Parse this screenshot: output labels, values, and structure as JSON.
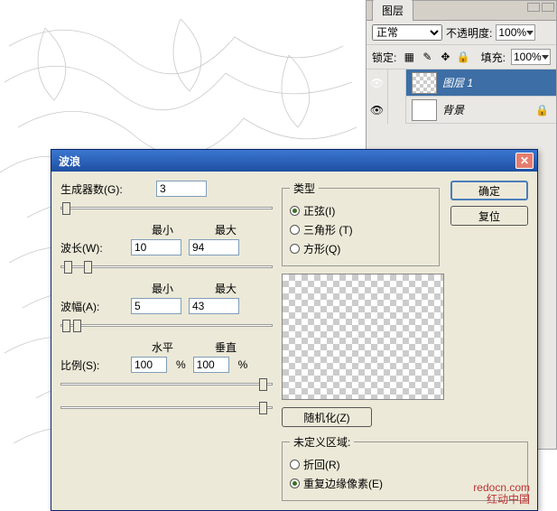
{
  "layers_panel": {
    "tab": "图层",
    "blend_mode": "正常",
    "opacity_label": "不透明度:",
    "opacity_value": "100%",
    "lock_label": "锁定:",
    "fill_label": "填充:",
    "fill_value": "100%",
    "layers": [
      {
        "name": "图层 1",
        "selected": true,
        "checker": true,
        "locked": false
      },
      {
        "name": "背景",
        "selected": false,
        "checker": false,
        "locked": true
      }
    ]
  },
  "dialog": {
    "title": "波浪",
    "generators_label": "生成器数(G):",
    "generators_value": "3",
    "min_label": "最小",
    "max_label": "最大",
    "wavelength_label": "波长(W):",
    "wavelength_min": "10",
    "wavelength_max": "94",
    "amplitude_label": "波幅(A):",
    "amplitude_min": "5",
    "amplitude_max": "43",
    "h_label": "水平",
    "v_label": "垂直",
    "scale_label": "比例(S):",
    "scale_h": "100",
    "scale_v": "100",
    "pct": "%",
    "type_legend": "类型",
    "type_sine": "正弦(I)",
    "type_tri": "三角形 (T)",
    "type_square": "方形(Q)",
    "ok": "确定",
    "reset": "复位",
    "randomize": "随机化(Z)",
    "undefined_legend": "未定义区域:",
    "wrap": "折回(R)",
    "repeat_edge": "重复边缘像素(E)"
  },
  "watermark": {
    "line1": "redocn.com",
    "line2": "红动中国"
  }
}
